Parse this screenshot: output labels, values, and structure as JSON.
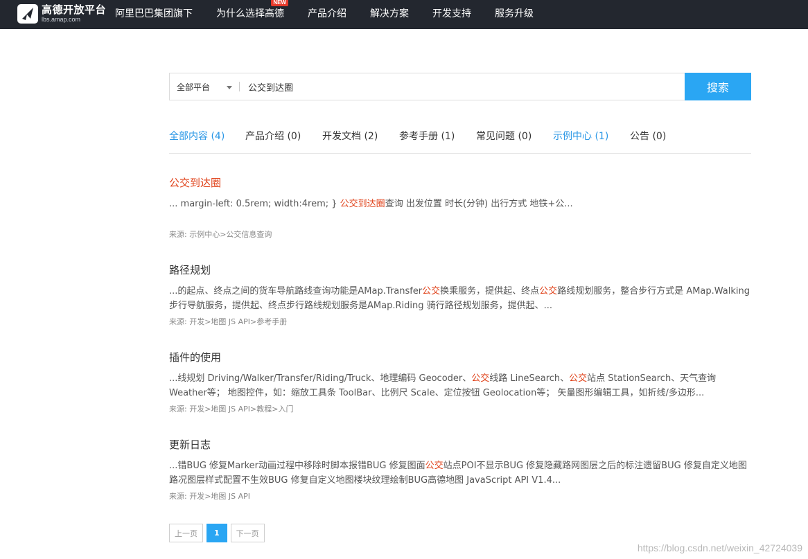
{
  "brand": {
    "title": "高德开放平台",
    "subtitle": "lbs.amap.com"
  },
  "nav": {
    "items": [
      {
        "label": "阿里巴巴集团旗下"
      },
      {
        "label": "为什么选择高德",
        "badge": "NEW"
      },
      {
        "label": "产品介绍"
      },
      {
        "label": "解决方案"
      },
      {
        "label": "开发支持"
      },
      {
        "label": "服务升级"
      }
    ]
  },
  "search": {
    "platform": "全部平台",
    "query": "公交到达圈",
    "button": "搜索"
  },
  "tabs": [
    {
      "label": "全部内容 (4)"
    },
    {
      "label": "产品介绍 (0)"
    },
    {
      "label": "开发文档 (2)"
    },
    {
      "label": "参考手册 (1)"
    },
    {
      "label": "常见问题 (0)"
    },
    {
      "label": "示例中心 (1)"
    },
    {
      "label": "公告 (0)"
    }
  ],
  "results": [
    {
      "title": "公交到达圈",
      "snippet": [
        {
          "t": "... margin-left: 0.5rem; width:4rem; } "
        },
        {
          "t": "公交到达圈",
          "kw": true
        },
        {
          "t": "查询 出发位置 时长(分钟) 出行方式 地铁+公..."
        }
      ],
      "source": "来源:   示例中心>公交信息查询"
    },
    {
      "title": "路径规划",
      "snippet": [
        {
          "t": "...的起点、终点之间的货车导航路线查询功能是AMap.Transfer"
        },
        {
          "t": "公交",
          "kw": true
        },
        {
          "t": "换乘服务，提供起、终点"
        },
        {
          "t": "公交",
          "kw": true
        },
        {
          "t": "路线规划服务，整合步行方式是 AMap.Walking 步行导航服务，提供起、终点步行路线规划服务是AMap.Riding 骑行路径规划服务，提供起、..."
        }
      ],
      "source": "来源:   开发>地图 JS API>参考手册"
    },
    {
      "title": "插件的使用",
      "snippet": [
        {
          "t": "...线规划 Driving/Walker/Transfer/Riding/Truck、地理编码 Geocoder、"
        },
        {
          "t": "公交",
          "kw": true
        },
        {
          "t": "线路 LineSearch、"
        },
        {
          "t": "公交",
          "kw": true
        },
        {
          "t": "站点 StationSearch、天气查询 Weather等； 地图控件，如：缩放工具条 ToolBar、比例尺 Scale、定位按钮 Geolocation等； 矢量图形编辑工具，如折线/多边形..."
        }
      ],
      "source": "来源:   开发>地图 JS API>教程>入门"
    },
    {
      "title": "更新日志",
      "snippet": [
        {
          "t": "...错BUG 修复Marker动画过程中移除时脚本报错BUG 修复图面"
        },
        {
          "t": "公交",
          "kw": true
        },
        {
          "t": "站点POI不显示BUG 修复隐藏路网图层之后的标注遗留BUG 修复自定义地图路况图层样式配置不生效BUG 修复自定义地图楼块纹理绘制BUG高德地图 JavaScript API V1.4..."
        }
      ],
      "source": "来源:   开发>地图 JS API"
    }
  ],
  "pager": {
    "prev": "上一页",
    "current": "1",
    "next": "下一页"
  },
  "watermark": "https://blog.csdn.net/weixin_42724039",
  "colors": {
    "nav_bg": "#23272f",
    "accent": "#2aa6f3",
    "keyword": "#e0421a",
    "active_tab": "#2a97e6"
  }
}
